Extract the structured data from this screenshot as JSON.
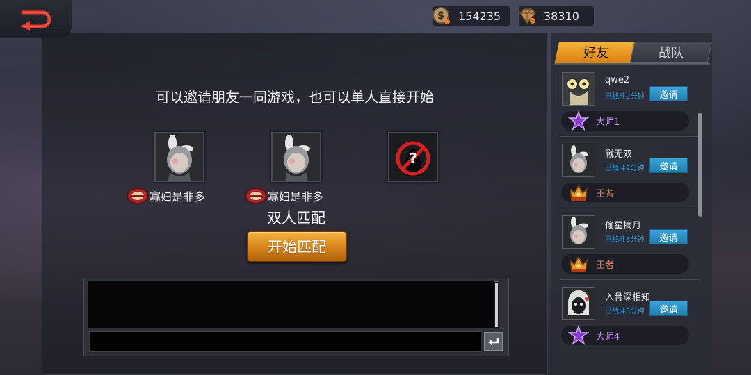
{
  "topbar": {
    "coins": "154235",
    "gems": "38310"
  },
  "lobby": {
    "subtitle": "可以邀请朋友一同游戏，也可以单人直接开始",
    "players": [
      {
        "name": "寡妇是非多"
      },
      {
        "name": "寡妇是非多"
      }
    ],
    "empty_slot_icon": "no-entry-icon",
    "mode_label": "双人匹配",
    "start_button": "开始匹配"
  },
  "chat": {
    "input_value": "",
    "send_icon": "enter-icon"
  },
  "side": {
    "tabs": [
      {
        "label": "好友",
        "active": true
      },
      {
        "label": "战队",
        "active": false
      }
    ],
    "friends": [
      {
        "name": "qwe2",
        "status": "已战斗2分钟",
        "invite": "邀请",
        "rank": "大师1",
        "rank_color": "#c98cf0",
        "rank_emblem": "purple-star-emblem"
      },
      {
        "name": "戰无双",
        "status": "已战斗2分钟",
        "invite": "邀请",
        "rank": "王者",
        "rank_color": "#e87b5a",
        "rank_emblem": "gold-crown-emblem"
      },
      {
        "name": "偷星摘月",
        "status": "已战斗3分钟",
        "invite": "邀请",
        "rank": "王者",
        "rank_color": "#e87b5a",
        "rank_emblem": "gold-crown-emblem"
      },
      {
        "name": "入骨深相知",
        "status": "已战斗5分钟",
        "invite": "邀请",
        "rank": "大师4",
        "rank_color": "#c98cf0",
        "rank_emblem": "purple-star-emblem"
      }
    ]
  },
  "colors": {
    "accent_orange": "#e59a26",
    "invite_blue": "#2b90c6",
    "status_blue": "#27a0e0"
  }
}
